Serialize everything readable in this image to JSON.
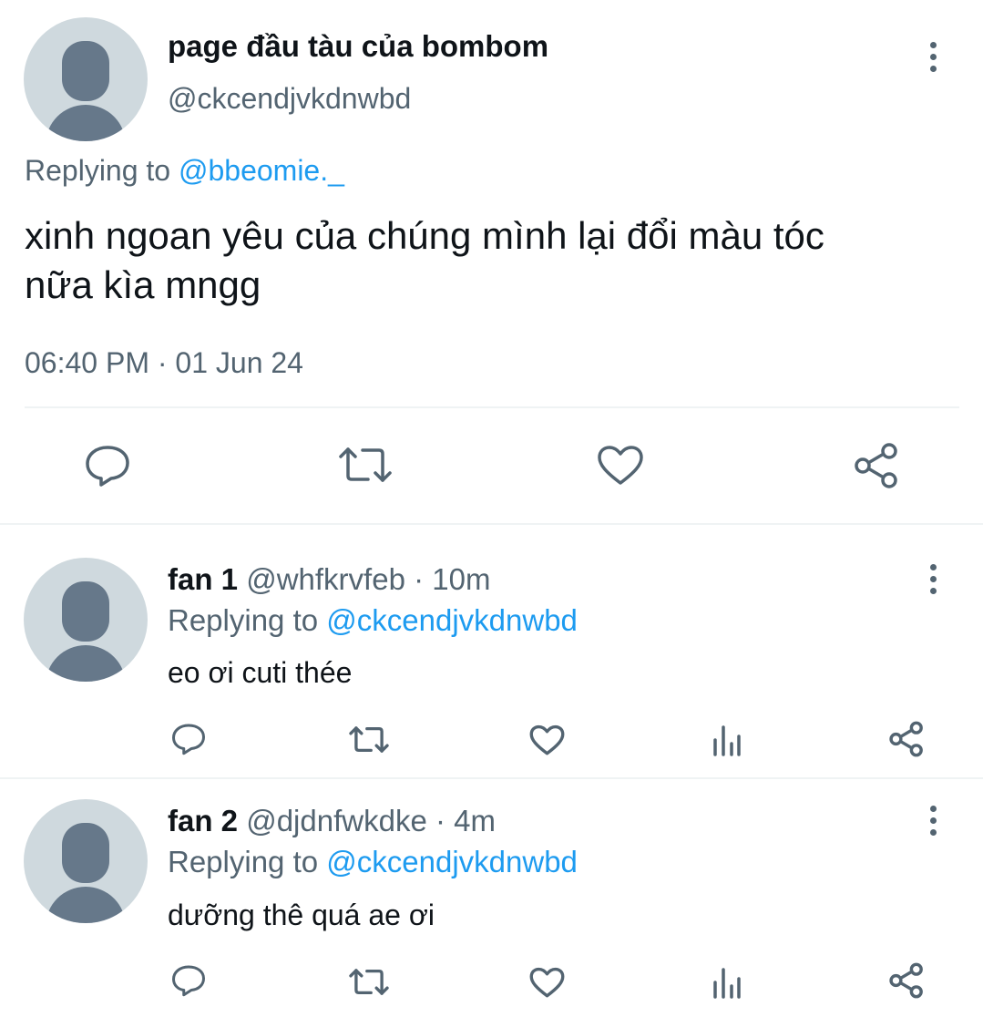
{
  "main_tweet": {
    "display_name": "page đầu tàu của bombom",
    "handle": "@ckcendjvkdnwbd",
    "replying_prefix": "Replying to",
    "replying_to": "@bbeomie._",
    "text_line1": "xinh ngoan yêu của chúng mình lại đổi màu tóc",
    "text_line2": "nữa kìa mngg",
    "time": "06:40 PM",
    "separator": "·",
    "date": "01 Jun 24"
  },
  "replies": [
    {
      "display_name": "fan 1",
      "handle": "@whfkrvfeb",
      "separator": "·",
      "age": "10m",
      "replying_prefix": "Replying to",
      "replying_to": "@ckcendjvkdnwbd",
      "text": "eo ơi cuti thée"
    },
    {
      "display_name": "fan 2",
      "handle": "@djdnfwkdke",
      "separator": "·",
      "age": "4m",
      "replying_prefix": "Replying to",
      "replying_to": "@ckcendjvkdnwbd",
      "text": "dưỡng thê quá ae ơi"
    }
  ],
  "icons": [
    "reply-icon",
    "retweet-icon",
    "like-icon",
    "share-icon",
    "views-icon",
    "more-icon",
    "avatar-icon"
  ],
  "colors": {
    "text": "#0f1419",
    "secondary": "#536471",
    "link": "#1d9bf0",
    "avatar_bg": "#cfd9de",
    "avatar_fg": "#66788a",
    "divider": "#eff3f4"
  }
}
